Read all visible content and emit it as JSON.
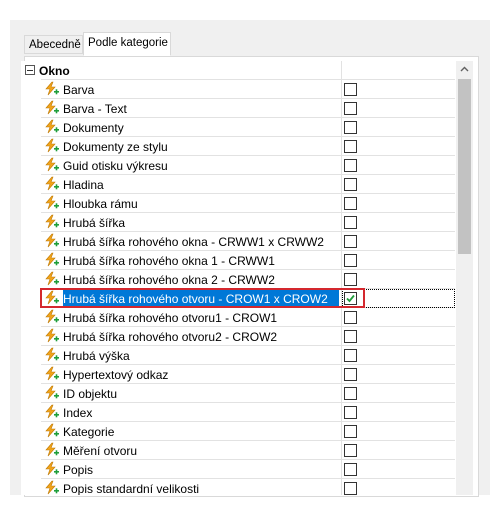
{
  "tabs": [
    {
      "label": "Abecedně"
    },
    {
      "label": "Podle kategorie"
    }
  ],
  "category": {
    "label": "Okno"
  },
  "rows": [
    {
      "label": "Barva",
      "checked": false
    },
    {
      "label": "Barva - Text",
      "checked": false
    },
    {
      "label": "Dokumenty",
      "checked": false
    },
    {
      "label": "Dokumenty ze stylu",
      "checked": false
    },
    {
      "label": "Guid otisku výkresu",
      "checked": false
    },
    {
      "label": "Hladina",
      "checked": false
    },
    {
      "label": "Hloubka rámu",
      "checked": false
    },
    {
      "label": "Hrubá šířka",
      "checked": false
    },
    {
      "label": "Hrubá šířka rohového okna - CRWW1 x CRWW2",
      "checked": false
    },
    {
      "label": "Hrubá šířka rohového okna 1 - CRWW1",
      "checked": false
    },
    {
      "label": "Hrubá šířka rohového okna 2 - CRWW2",
      "checked": false
    },
    {
      "label": "Hrubá šířka rohového otvoru - CROW1 x CROW2",
      "checked": true,
      "selected": true
    },
    {
      "label": "Hrubá šířka rohového otvoru1 - CROW1",
      "checked": false
    },
    {
      "label": "Hrubá šířka rohového otvoru2 - CROW2",
      "checked": false
    },
    {
      "label": "Hrubá výška",
      "checked": false
    },
    {
      "label": "Hypertextový odkaz",
      "checked": false
    },
    {
      "label": "ID objektu",
      "checked": false
    },
    {
      "label": "Index",
      "checked": false
    },
    {
      "label": "Kategorie",
      "checked": false
    },
    {
      "label": "Měření otvoru",
      "checked": false
    },
    {
      "label": "Popis",
      "checked": false
    },
    {
      "label": "Popis standardní velikosti",
      "checked": false
    }
  ],
  "colors": {
    "selection": "#0078d7",
    "highlight_border": "#d4282e",
    "check_green": "#1e9e3a"
  }
}
